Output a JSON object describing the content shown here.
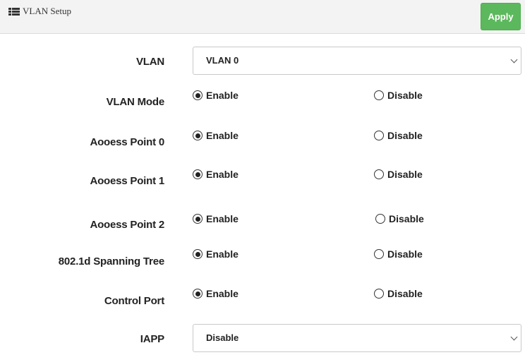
{
  "header": {
    "title": "VLAN Setup",
    "apply_label": "Apply"
  },
  "form": {
    "vlan": {
      "label": "VLAN",
      "value": "VLAN 0"
    },
    "rows": [
      {
        "label": "VLAN Mode",
        "enable": "Enable",
        "disable": "Disable",
        "selected": "enable"
      },
      {
        "label": "Aooess Point 0",
        "enable": "Enable",
        "disable": "Disable",
        "selected": "enable"
      },
      {
        "label": "Aooess Point 1",
        "enable": "Enable",
        "disable": "Disable",
        "selected": "enable"
      },
      {
        "label": "Aooess Point 2",
        "enable": "Enable",
        "disable": "Disable",
        "selected": "enable"
      },
      {
        "label": "802.1d Spanning Tree",
        "enable": "Enable",
        "disable": "Disable",
        "selected": "enable"
      },
      {
        "label": "Control Port",
        "enable": "Enable",
        "disable": "Disable",
        "selected": "enable"
      }
    ],
    "iapp": {
      "label": "IAPP",
      "value": "Disable"
    }
  },
  "colors": {
    "apply_bg": "#5cb85c",
    "header_bg": "#f3f3f3"
  }
}
